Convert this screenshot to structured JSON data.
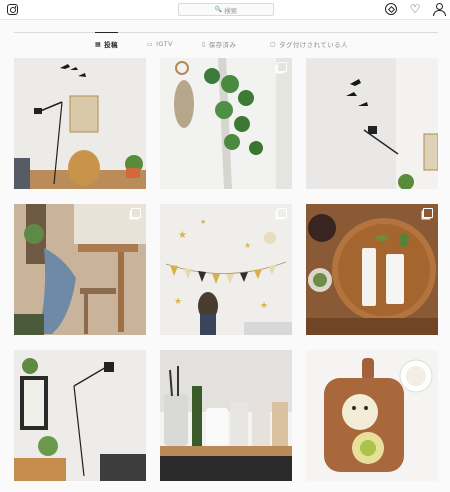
{
  "header": {
    "search_placeholder": "検索",
    "icons": [
      "instagram-logo-icon",
      "search-icon",
      "compass-icon",
      "heart-icon",
      "person-icon"
    ]
  },
  "tabs": [
    {
      "label": "投稿",
      "icon": "grid-icon",
      "active": true
    },
    {
      "label": "IGTV",
      "icon": "tv-icon",
      "active": false
    },
    {
      "label": "保存済み",
      "icon": "bookmark-icon",
      "active": false
    },
    {
      "label": "タグ付けされている人",
      "icon": "tag-icon",
      "active": false
    }
  ],
  "posts": [
    {
      "name": "post-bird-mobile-lamp-chair",
      "multi": false
    },
    {
      "name": "post-hanging-plants",
      "multi": true
    },
    {
      "name": "post-bird-mobile-lamp",
      "multi": false
    },
    {
      "name": "post-chair-with-denim",
      "multi": true
    },
    {
      "name": "post-child-birthday-garland",
      "multi": true
    },
    {
      "name": "post-tray-with-bottles",
      "multi": true
    },
    {
      "name": "post-floor-lamp-corner",
      "multi": false
    },
    {
      "name": "post-kitchen-counter-jars",
      "multi": false
    },
    {
      "name": "post-cutting-board-toast",
      "multi": false
    }
  ],
  "colors": {
    "accent": "#262626",
    "muted": "#8e8e8e",
    "border": "#dbdbdb",
    "background": "#fafafa"
  }
}
